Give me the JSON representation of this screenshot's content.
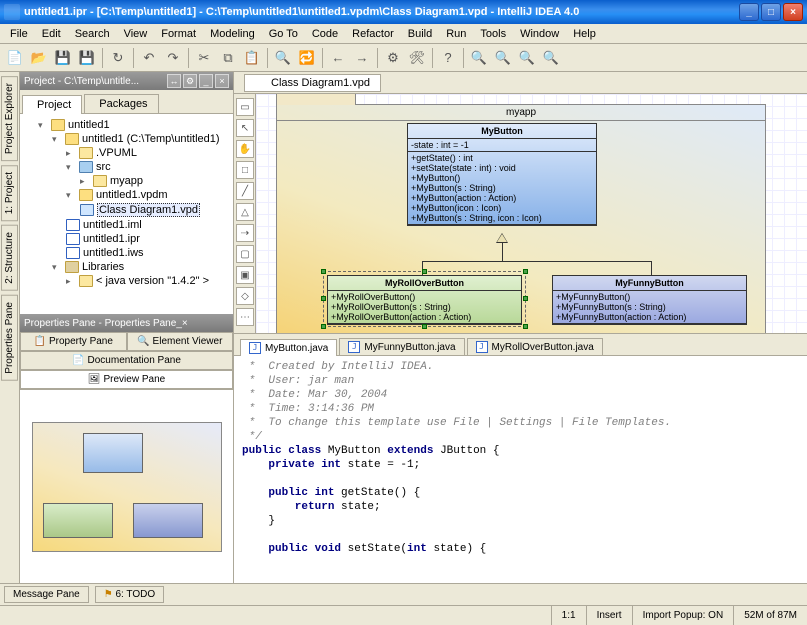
{
  "window": {
    "title": "untitled1.ipr - [C:\\Temp\\untitled1] - C:\\Temp\\untitled1\\untitled1.vpdm\\Class Diagram1.vpd - IntelliJ IDEA 4.0"
  },
  "menu": [
    "File",
    "Edit",
    "Search",
    "View",
    "Format",
    "Modeling",
    "Go To",
    "Code",
    "Refactor",
    "Build",
    "Run",
    "Tools",
    "Window",
    "Help"
  ],
  "sideTabs": [
    "Project Explorer",
    "1: Project",
    "2: Structure",
    "Properties Pane"
  ],
  "projectPane": {
    "title": "Project - C:\\Temp\\untitle...",
    "tabs": {
      "project": "Project",
      "packages": "Packages"
    },
    "tree": {
      "root": "untitled1",
      "module": "untitled1 (C:\\Temp\\untitled1)",
      "vpuml": ".VPUML",
      "src": "src",
      "myapp": "myapp",
      "vpdm": "untitled1.vpdm",
      "diagram": "Class Diagram1.vpd",
      "iml": "untitled1.iml",
      "ipr": "untitled1.ipr",
      "iws": "untitled1.iws",
      "libraries": "Libraries",
      "java": "< java version \"1.4.2\" >"
    }
  },
  "propsPane": {
    "title": "Properties Pane - Properties Pane",
    "tabs": {
      "property": "Property Pane",
      "element": "Element Viewer",
      "doc": "Documentation Pane",
      "preview": "Preview Pane"
    }
  },
  "diagram": {
    "tab": "Class Diagram1.vpd",
    "package": "myapp",
    "MyButton": {
      "name": "MyButton",
      "attrs": [
        "-state : int = -1"
      ],
      "ops": [
        "+getState() : int",
        "+setState(state : int) : void",
        "+MyButton()",
        "+MyButton(s : String)",
        "+MyButton(action : Action)",
        "+MyButton(icon : Icon)",
        "+MyButton(s : String, icon : Icon)"
      ]
    },
    "MyRollOverButton": {
      "name": "MyRollOverButton",
      "ops": [
        "+MyRollOverButton()",
        "+MyRollOverButton(s : String)",
        "+MyRollOverButton(action : Action)"
      ]
    },
    "MyFunnyButton": {
      "name": "MyFunnyButton",
      "ops": [
        "+MyFunnyButton()",
        "+MyFunnyButton(s : String)",
        "+MyFunnyButton(action : Action)"
      ]
    }
  },
  "editorTabs": {
    "a": "MyButton.java",
    "b": "MyFunnyButton.java",
    "c": "MyRollOverButton.java"
  },
  "code": {
    "l1": " *  Created by IntelliJ IDEA.",
    "l2": " *  User: jar man",
    "l3": " *  Date: Mar 30, 2004",
    "l4": " *  Time: 3:14:36 PM",
    "l5": " *  To change this template use File | Settings | File Templates.",
    "l6": " */",
    "l7a": "public class ",
    "l7b": "MyButton ",
    "l7c": "extends ",
    "l7d": "JButton {",
    "l8a": "    private int ",
    "l8b": "state = -1;",
    "l9a": "    public int ",
    "l9b": "getState() {",
    "l10a": "        return ",
    "l10b": "state;",
    "l11": "    }",
    "l12a": "    public void ",
    "l12b": "setState(",
    "l12c": "int ",
    "l12d": "state) {"
  },
  "bottom": {
    "msg": "Message Pane",
    "todo": "6: TODO"
  },
  "status": {
    "pos": "1:1",
    "insert": "Insert",
    "popup": "Import Popup: ON",
    "mem": "52M of 87M"
  }
}
